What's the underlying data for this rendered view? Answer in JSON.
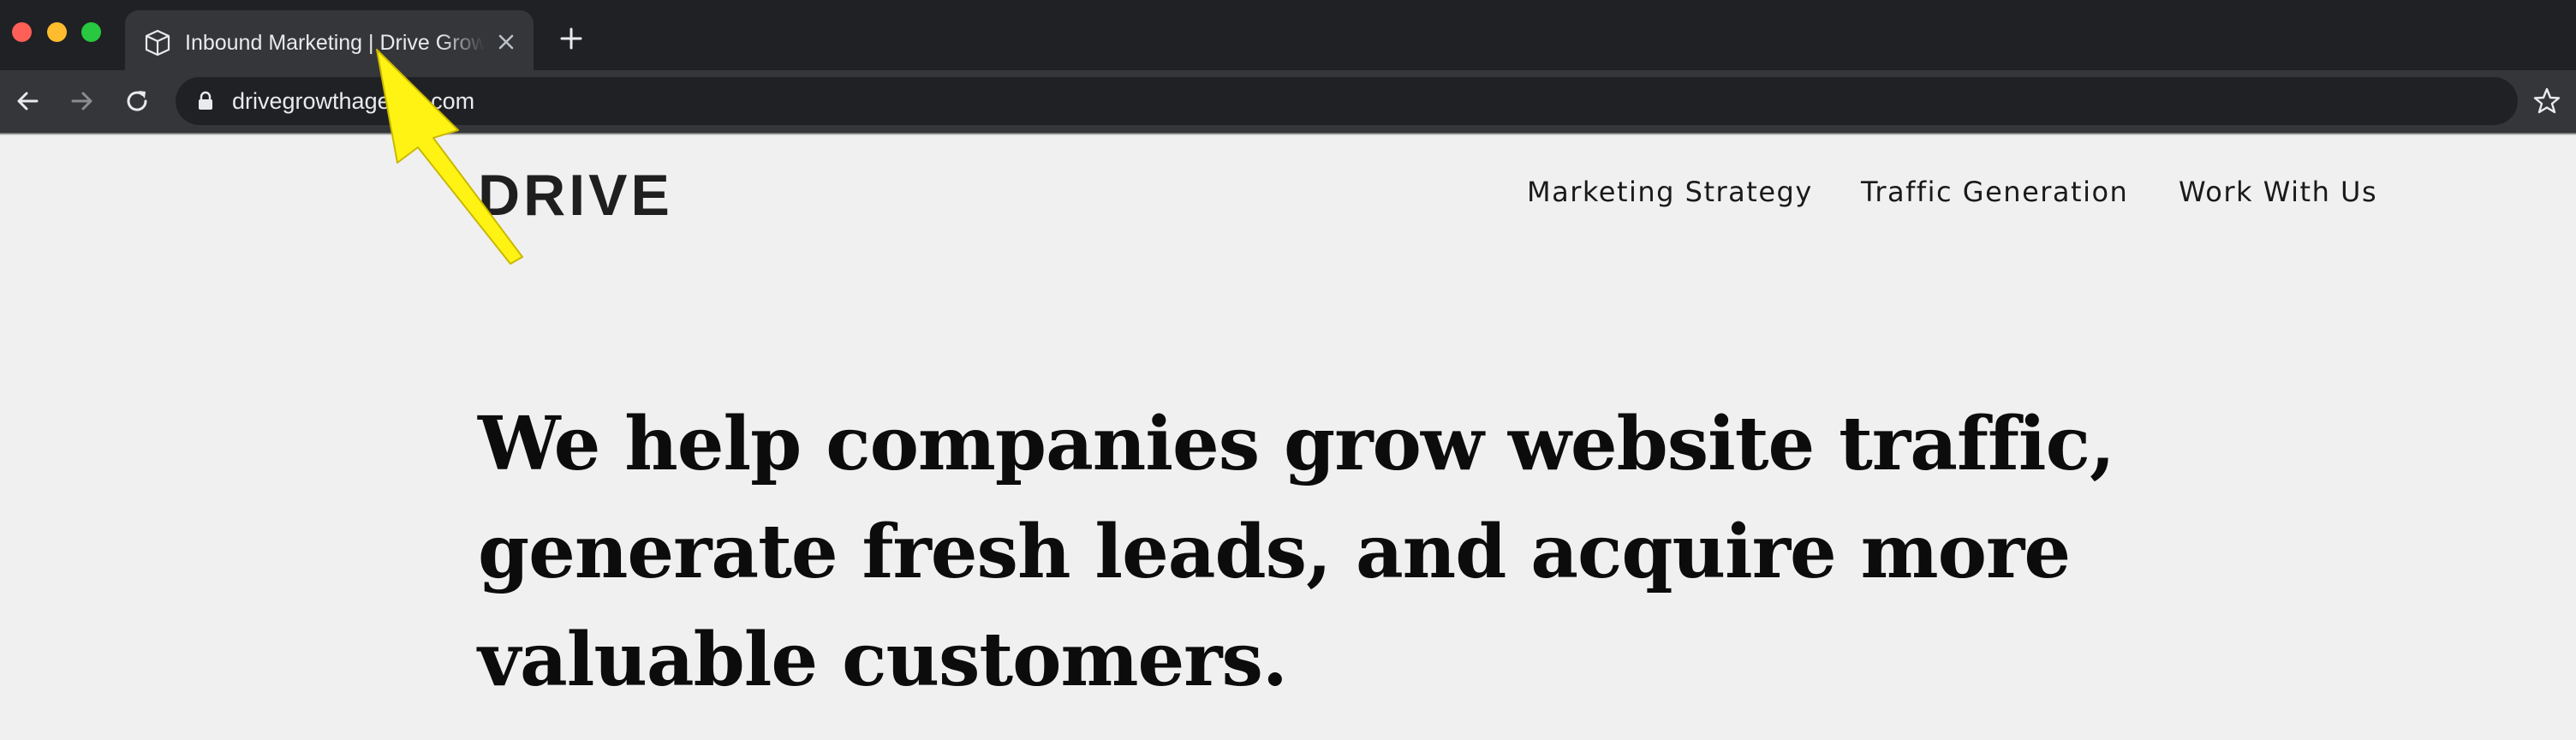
{
  "browser": {
    "tab": {
      "title": "Inbound Marketing | Drive Growth Agency",
      "favicon": "cube-icon",
      "close_icon": "close-icon"
    },
    "new_tab_icon": "plus-icon",
    "window_controls": {
      "close_color": "#fe5f57",
      "minimize_color": "#febc2e",
      "maximize_color": "#28c840"
    },
    "toolbar": {
      "back_icon": "arrow-left-icon",
      "forward_icon": "arrow-right-icon",
      "reload_icon": "reload-icon",
      "lock_icon": "lock-icon",
      "url": "drivegrowthagency.com",
      "bookmark_icon": "star-icon"
    }
  },
  "site": {
    "logo": "DRIVE",
    "nav": [
      "Marketing Strategy",
      "Traffic Generation",
      "Work With Us"
    ],
    "hero_heading_lines": [
      "We help companies grow website traffic,",
      "generate fresh leads, and acquire more",
      "valuable customers."
    ]
  },
  "annotation": {
    "icon": "arrow-pointer-icon",
    "color": "#fff314"
  },
  "colors": {
    "page_background": "#f0f0f0",
    "chrome_dark": "#202124",
    "chrome_toolbar": "#35363a"
  }
}
